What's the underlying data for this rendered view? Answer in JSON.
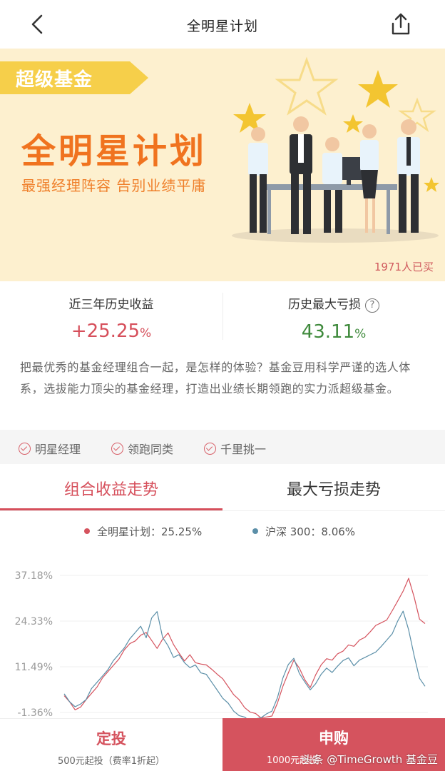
{
  "header": {
    "title": "全明星计划"
  },
  "banner": {
    "tag": "超级基金",
    "title": "全明星计划",
    "subtitle": "最强经理阵容 告别业绩平庸",
    "buyers": "1971人已买"
  },
  "stats": {
    "left": {
      "label": "近三年历史收益",
      "value": "+25.25",
      "unit": "%"
    },
    "right": {
      "label": "历史最大亏损",
      "value": "43.11",
      "unit": "%",
      "help": "?"
    }
  },
  "description": "把最优秀的基金经理组合一起，是怎样的体验？基金豆用科学严谨的选人体系，选拔能力顶尖的基金经理，打造出业绩长期领跑的实力派超级基金。",
  "features": [
    "明星经理",
    "领跑同类",
    "千里挑一"
  ],
  "tabs": [
    {
      "label": "组合收益走势"
    },
    {
      "label": "最大亏损走势"
    }
  ],
  "legend": [
    {
      "label": "全明星计划：25.25%",
      "color": "#d5535e"
    },
    {
      "label": "沪深 300：8.06%",
      "color": "#5b8fa8"
    }
  ],
  "chart_data": {
    "type": "line",
    "y_ticks": [
      "37.18%",
      "24.33%",
      "11.49%",
      "-1.36%"
    ],
    "ylim": [
      -1.36,
      37.18
    ],
    "series": [
      {
        "name": "全明星计划",
        "color": "#d5535e",
        "values": [
          3,
          1.5,
          -0.5,
          0.5,
          2,
          4,
          6,
          8,
          10,
          12,
          14,
          16,
          18,
          19,
          20,
          21,
          19,
          17,
          19,
          21,
          18,
          15,
          13,
          15,
          13,
          12,
          12,
          11,
          9,
          8,
          6,
          4,
          2,
          0,
          -1,
          -2,
          -3,
          -2.5,
          -2,
          1,
          6,
          10,
          13,
          11,
          8,
          6,
          9,
          12,
          14,
          13,
          15,
          16,
          18,
          17,
          19,
          20,
          21,
          23,
          24,
          25,
          27,
          30,
          33,
          36,
          31,
          25,
          24
        ]
      },
      {
        "name": "沪深 300",
        "color": "#5b8fa8",
        "values": [
          4,
          2,
          0,
          1,
          2.5,
          5,
          7,
          9,
          11,
          13,
          15,
          17,
          19,
          21,
          23,
          20,
          25,
          27,
          20,
          17,
          14,
          15,
          13,
          11,
          12,
          10,
          9,
          7,
          5,
          3,
          1,
          -1,
          -2,
          -3,
          -4,
          -3,
          -2.5,
          -2,
          -1,
          3,
          8,
          12,
          14,
          10,
          7,
          5,
          7,
          9,
          11,
          10,
          12,
          13,
          14,
          12,
          13,
          14,
          15,
          16,
          17,
          19,
          21,
          24,
          27,
          22,
          15,
          8,
          6
        ]
      }
    ]
  },
  "bottom": {
    "left": {
      "label": "定投",
      "sub": "500元起投（费率1折起）"
    },
    "right": {
      "label": "申购",
      "sub": "1000元起投"
    },
    "watermark": "头条 @TimeGrowth  基金豆"
  }
}
